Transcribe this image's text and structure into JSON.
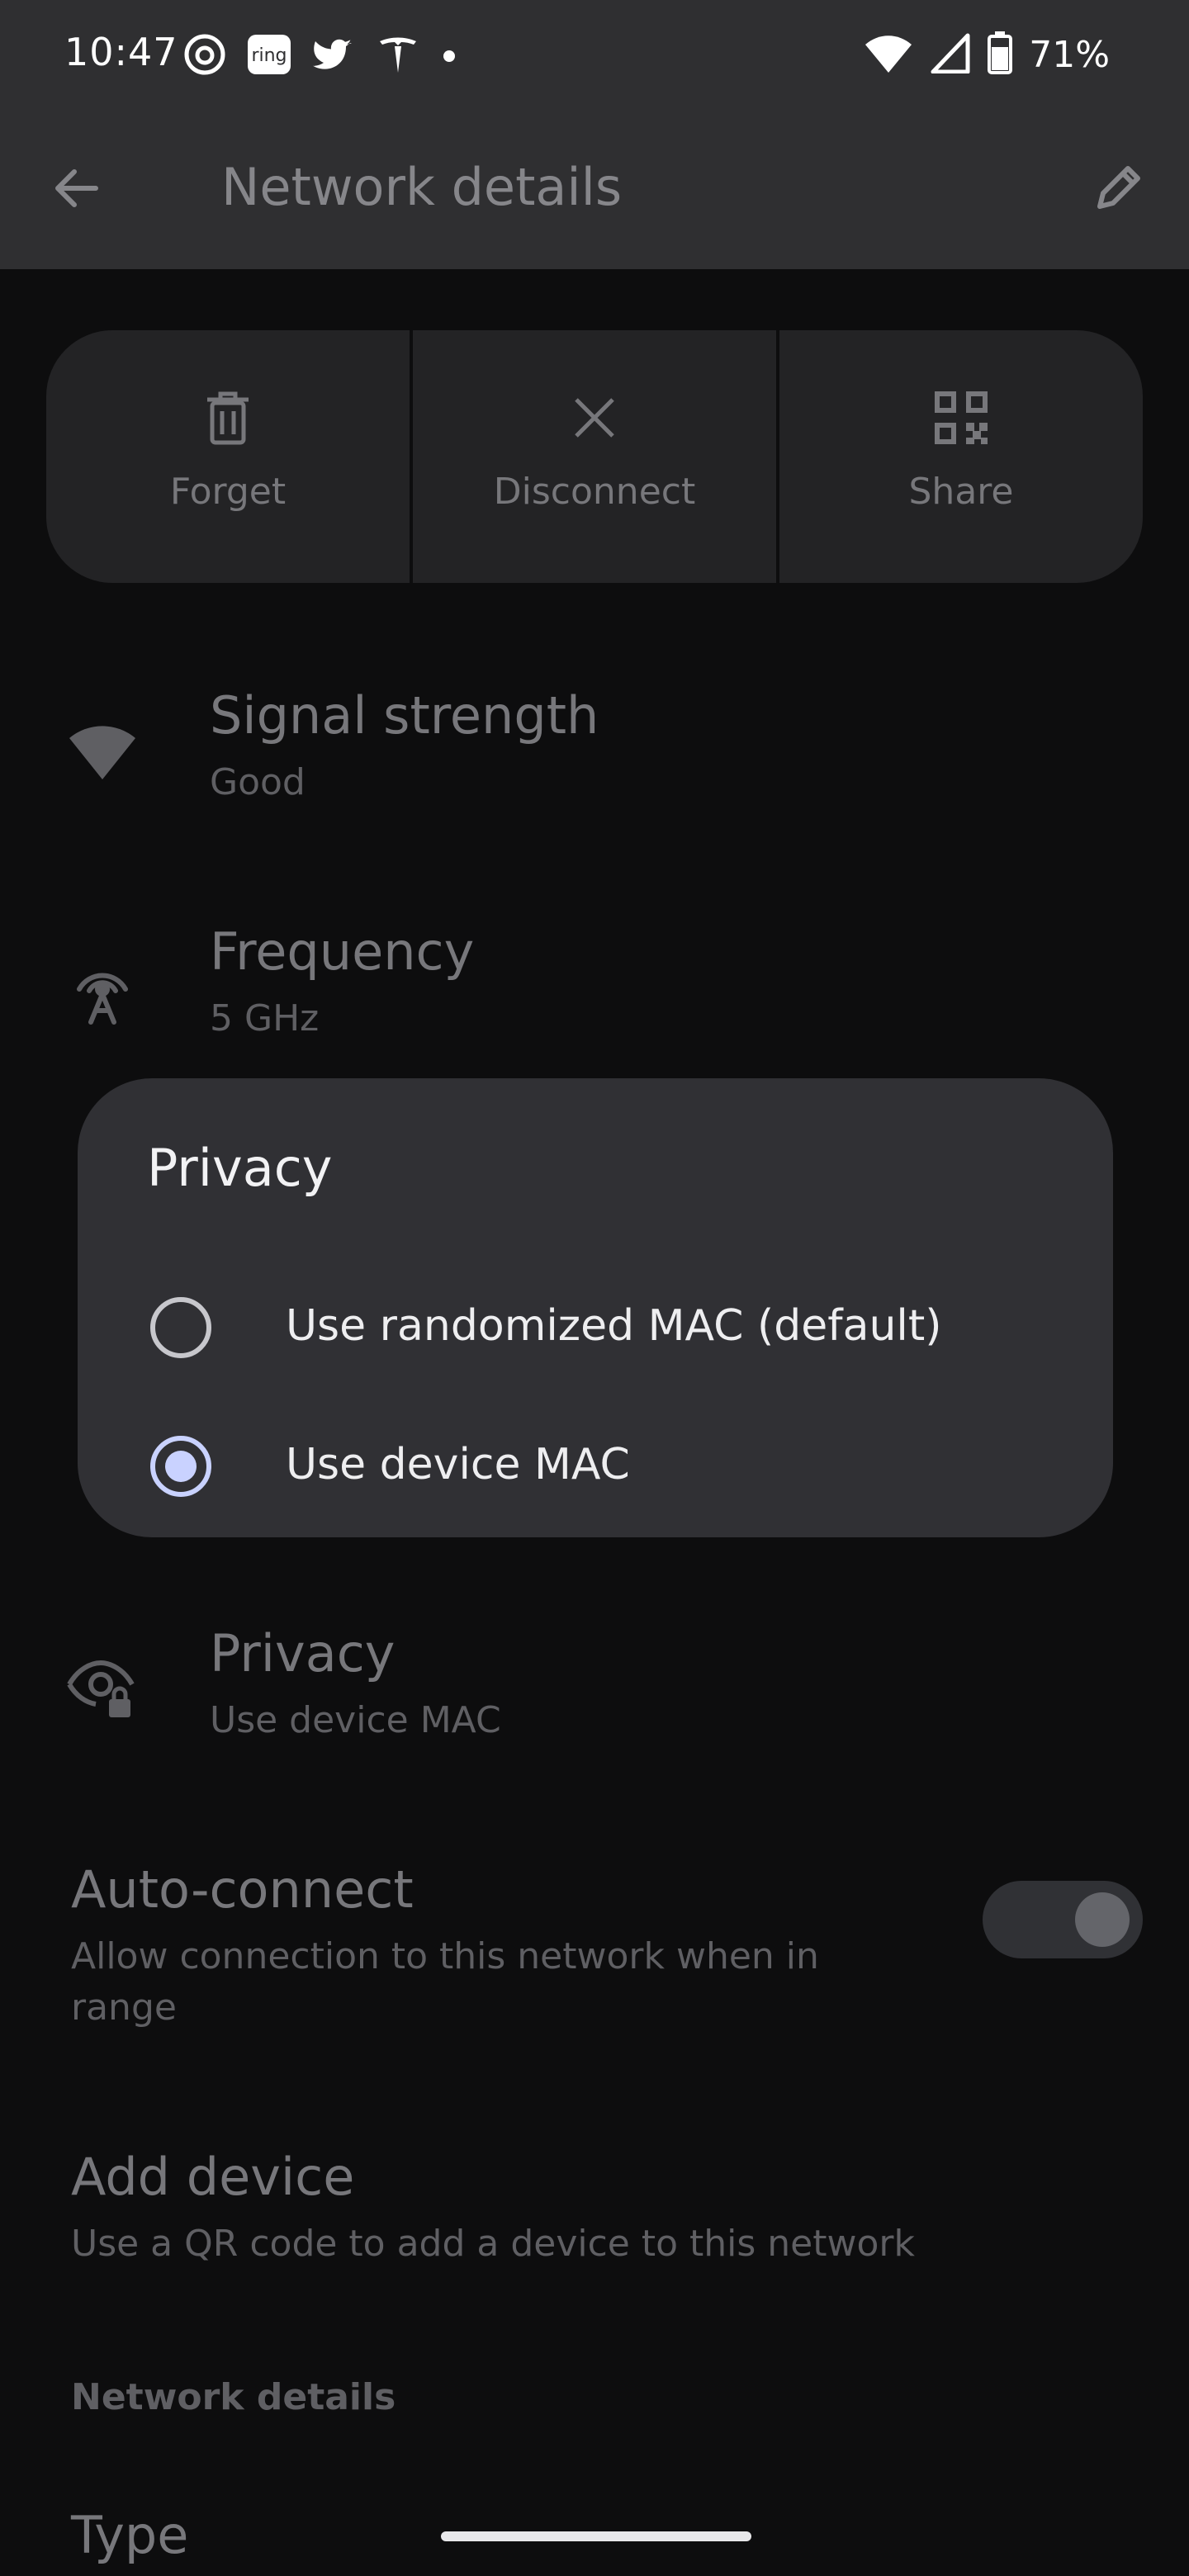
{
  "status_bar": {
    "time": "10:47",
    "notification_icons": [
      "threads-icon",
      "ring-icon",
      "twitter-icon",
      "tesla-icon",
      "more-notifications-dot"
    ],
    "ring_text": "ring",
    "battery_percent": "71%"
  },
  "app_bar": {
    "title": "Network details"
  },
  "actions": [
    {
      "label": "Forget",
      "icon": "trash-icon"
    },
    {
      "label": "Disconnect",
      "icon": "close-icon"
    },
    {
      "label": "Share",
      "icon": "qr-code-icon"
    }
  ],
  "rows": {
    "signal": {
      "title": "Signal strength",
      "value": "Good"
    },
    "frequency": {
      "title": "Frequency",
      "value": "5 GHz"
    },
    "privacy": {
      "title": "Privacy",
      "value": "Use device MAC"
    },
    "auto_connect": {
      "title": "Auto-connect",
      "subtitle_line1": "Allow connection to this network when in",
      "subtitle_line2": "range",
      "enabled": true
    },
    "add_device": {
      "title": "Add device",
      "subtitle": "Use a QR code to add a device to this network"
    },
    "type": {
      "title": "Type"
    }
  },
  "section_header": "Network details",
  "dialog": {
    "title": "Privacy",
    "options": [
      {
        "label": "Use randomized MAC (default)",
        "selected": false
      },
      {
        "label": "Use device MAC",
        "selected": true
      }
    ]
  },
  "colors": {
    "accent": "#c9d2ff",
    "dialog_bg": "#303034",
    "scrim_bg": "#0d0d0e"
  }
}
